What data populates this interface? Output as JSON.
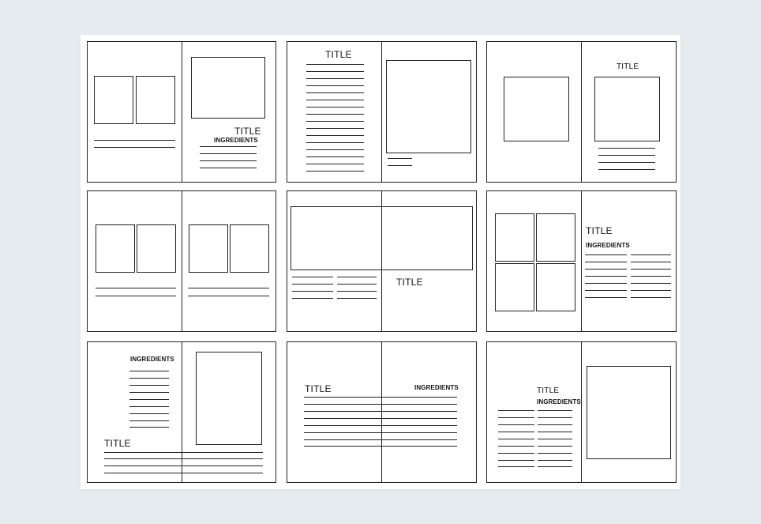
{
  "labels": {
    "title": "TITLE",
    "ingredients": "INGREDIENTS"
  }
}
